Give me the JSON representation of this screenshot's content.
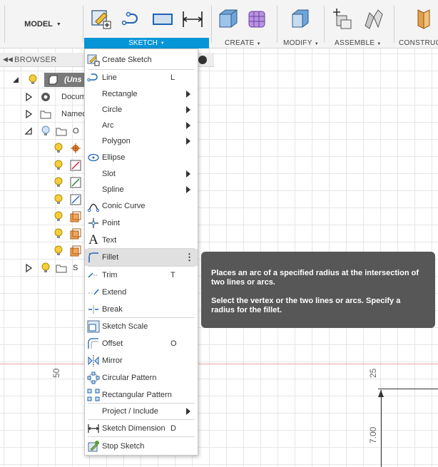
{
  "toolbar": {
    "workspace_label": "MODEL",
    "groups": {
      "sketch": "SKETCH",
      "create": "CREATE",
      "modify": "MODIFY",
      "assemble": "ASSEMBLE",
      "construct": "CONSTRUCT"
    },
    "accent_color": "#0696d7"
  },
  "browser": {
    "title": "BROWSER",
    "items": [
      {
        "label": "(Uns",
        "icon": "component-icon"
      },
      {
        "label": "Docum",
        "icon": "gear-icon"
      },
      {
        "label": "Named",
        "icon": "folder-icon"
      },
      {
        "label": "O",
        "icon": "folder-icon"
      },
      {
        "label": "S",
        "icon": "folder-icon"
      }
    ]
  },
  "menu": {
    "items": [
      {
        "label": "Create Sketch",
        "icon": "create-sketch-icon"
      },
      {
        "label": "Line",
        "shortcut": "L",
        "icon": "line-icon"
      },
      {
        "label": "Rectangle",
        "submenu": true
      },
      {
        "label": "Circle",
        "submenu": true
      },
      {
        "label": "Arc",
        "submenu": true
      },
      {
        "label": "Polygon",
        "submenu": true
      },
      {
        "label": "Ellipse",
        "icon": "ellipse-icon"
      },
      {
        "label": "Slot",
        "submenu": true
      },
      {
        "label": "Spline",
        "submenu": true
      },
      {
        "label": "Conic Curve",
        "icon": "conic-curve-icon"
      },
      {
        "label": "Point",
        "icon": "point-icon"
      },
      {
        "label": "Text",
        "icon": "text-icon"
      },
      {
        "label": "Fillet",
        "icon": "fillet-icon",
        "highlighted": true
      },
      {
        "label": "Trim",
        "shortcut": "T",
        "icon": "trim-icon"
      },
      {
        "label": "Extend",
        "icon": "extend-icon"
      },
      {
        "label": "Break",
        "icon": "break-icon"
      },
      {
        "label": "Sketch Scale",
        "icon": "sketch-scale-icon"
      },
      {
        "label": "Offset",
        "shortcut": "O",
        "icon": "offset-icon"
      },
      {
        "label": "Mirror",
        "icon": "mirror-icon"
      },
      {
        "label": "Circular Pattern",
        "icon": "circular-pattern-icon"
      },
      {
        "label": "Rectangular Pattern",
        "icon": "rectangular-pattern-icon"
      },
      {
        "label": "Project / Include",
        "submenu": true
      },
      {
        "label": "Sketch Dimension",
        "shortcut": "D",
        "icon": "sketch-dimension-icon"
      },
      {
        "label": "Stop Sketch",
        "icon": "stop-sketch-icon"
      }
    ]
  },
  "tooltip": {
    "line1": "Places an arc of a specified radius at the intersection of two lines or arcs.",
    "line2": "Select the vertex or the two lines or arcs. Specify a radius for the fillet."
  },
  "canvas": {
    "ruler_left": "50",
    "ruler_right": "25",
    "dimension": "7.00"
  }
}
